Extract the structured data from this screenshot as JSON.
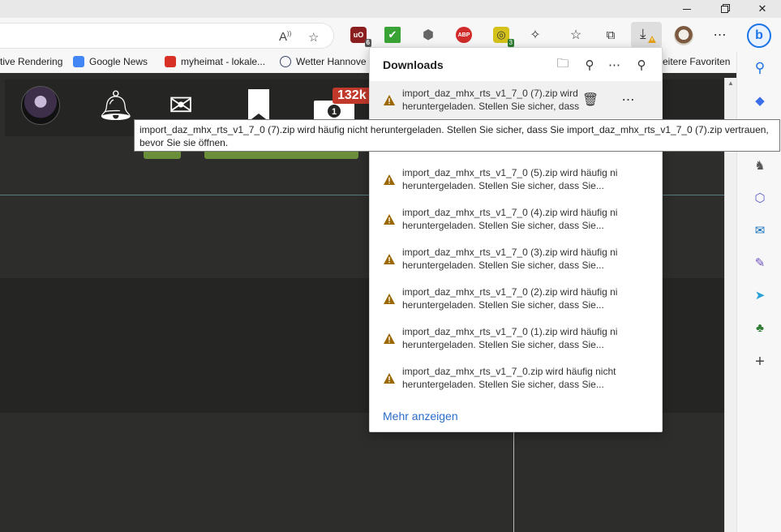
{
  "favorites": [
    {
      "label": "tive Rendering",
      "color": ""
    },
    {
      "label": "Google News",
      "color": "#4285f4"
    },
    {
      "label": "myheimat - lokale...",
      "color": "#d93025"
    },
    {
      "label": "Wetter Hannove",
      "color": "#3a4a6b"
    },
    {
      "label": "eitere Favoriten",
      "color": ""
    }
  ],
  "extensions": {
    "ublock_badge": "6",
    "third_badge": "3"
  },
  "page": {
    "counter": "132k"
  },
  "downloads": {
    "title": "Downloads",
    "items": [
      {
        "line1": "import_daz_mhx_rts_v1_7_0 (7).zip wird",
        "line2": "heruntergeladen. Stellen Sie sicher, dass"
      },
      {
        "line1": "import_daz_mhx_rts_v1_7_0 (5).zip wird häufig nicht",
        "line2": "heruntergeladen. Stellen Sie sicher, dass Sie..."
      },
      {
        "line1": "import_daz_mhx_rts_v1_7_0 (4).zip wird häufig nicht",
        "line2": "heruntergeladen. Stellen Sie sicher, dass Sie..."
      },
      {
        "line1": "import_daz_mhx_rts_v1_7_0 (3).zip wird häufig nicht",
        "line2": "heruntergeladen. Stellen Sie sicher, dass Sie..."
      },
      {
        "line1": "import_daz_mhx_rts_v1_7_0 (2).zip wird häufig nicht",
        "line2": "heruntergeladen. Stellen Sie sicher, dass Sie..."
      },
      {
        "line1": "import_daz_mhx_rts_v1_7_0 (1).zip wird häufig nicht",
        "line2": "heruntergeladen. Stellen Sie sicher, dass Sie..."
      },
      {
        "line1": "import_daz_mhx_rts_v1_7_0.zip wird häufig nicht",
        "line2": "heruntergeladen. Stellen Sie sicher, dass Sie..."
      }
    ],
    "more_label": "Mehr anzeigen"
  },
  "tooltip": {
    "text": "import_daz_mhx_rts_v1_7_0 (7).zip wird häufig nicht heruntergeladen. Stellen Sie sicher, dass Sie import_daz_mhx_rts_v1_7_0 (7).zip vertrauen, bevor Sie sie öffnen."
  },
  "colors": {
    "accent": "#2b6bc9",
    "warning": "#9a6700",
    "page_bg": "#2d2d2b"
  }
}
